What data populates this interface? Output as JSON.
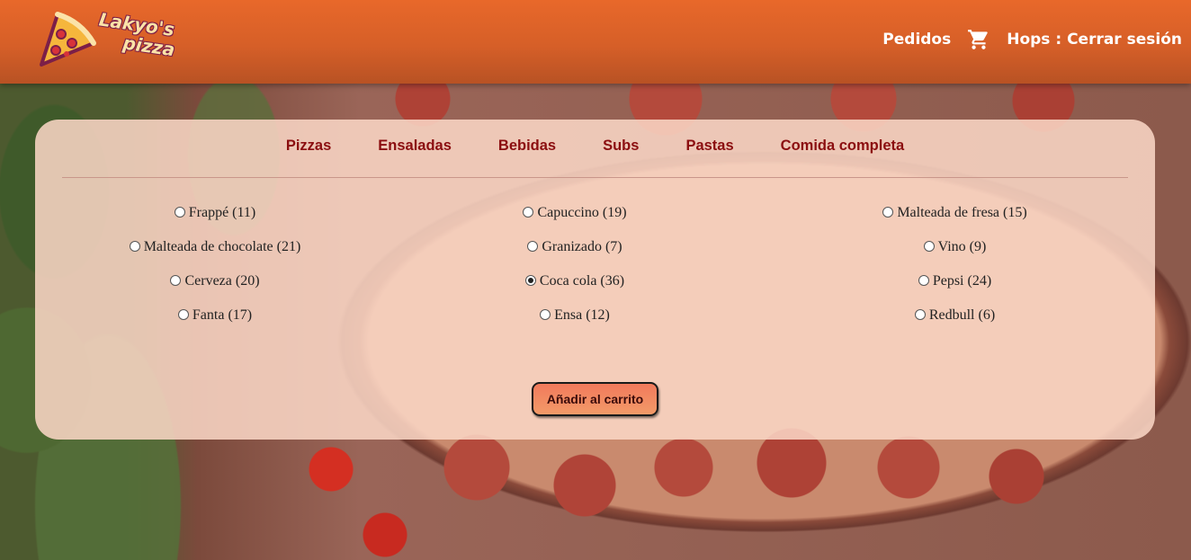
{
  "header": {
    "logo_line1": "Lakyo's",
    "logo_line2": "pizza",
    "orders_link": "Pedidos",
    "cart_icon": "shopping-cart-icon",
    "user_logout": "Hops : Cerrar sesión"
  },
  "tabs": [
    {
      "label": "Pizzas"
    },
    {
      "label": "Ensaladas"
    },
    {
      "label": "Bebidas"
    },
    {
      "label": "Subs"
    },
    {
      "label": "Pastas"
    },
    {
      "label": "Comida completa"
    }
  ],
  "options": [
    {
      "label": "Frappé (11)",
      "checked": false
    },
    {
      "label": "Capuccino (19)",
      "checked": false
    },
    {
      "label": "Malteada de fresa (15)",
      "checked": false
    },
    {
      "label": "Malteada de chocolate (21)",
      "checked": false
    },
    {
      "label": "Granizado (7)",
      "checked": false
    },
    {
      "label": "Vino (9)",
      "checked": false
    },
    {
      "label": "Cerveza (20)",
      "checked": false
    },
    {
      "label": "Coca cola (36)",
      "checked": true
    },
    {
      "label": "Pepsi (24)",
      "checked": false
    },
    {
      "label": "Fanta (17)",
      "checked": false
    },
    {
      "label": "Ensa (12)",
      "checked": false
    },
    {
      "label": "Redbull (6)",
      "checked": false
    }
  ],
  "add_to_cart": "Añadir al carrito",
  "colors": {
    "header": "#e8682a",
    "tab_text": "#8b0e10",
    "button": "#f17a5c"
  }
}
